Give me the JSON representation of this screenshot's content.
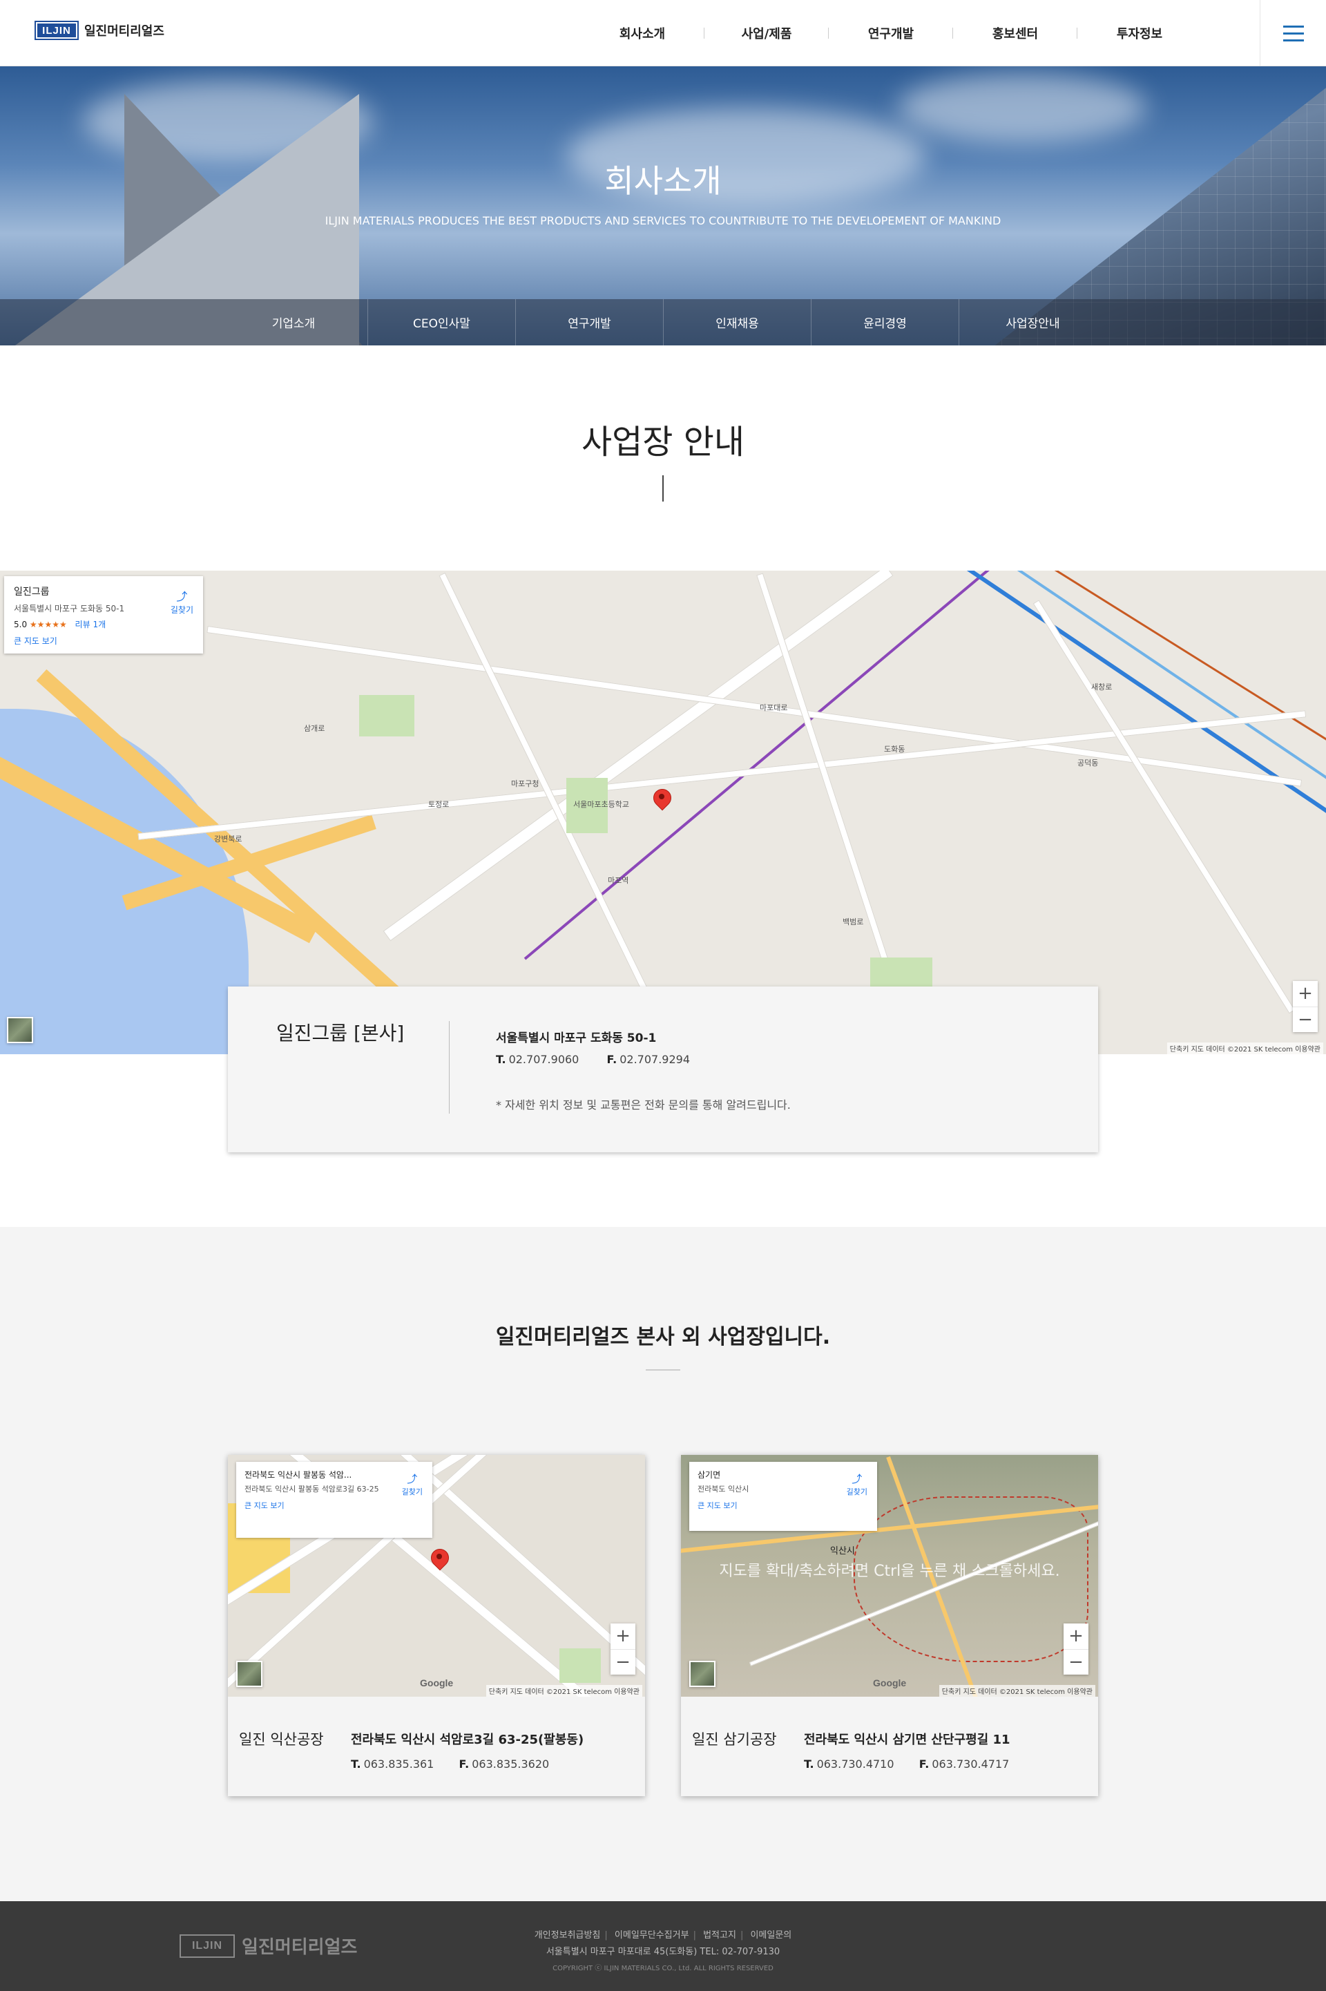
{
  "header": {
    "logo_mark": "ILJIN",
    "logo_text": "일진머티리얼즈",
    "nav": [
      "회사소개",
      "사업/제품",
      "연구개발",
      "홍보센터",
      "투자정보"
    ]
  },
  "hero": {
    "title": "회사소개",
    "subtitle": "ILJIN MATERIALS PRODUCES THE BEST PRODUCTS AND SERVICES TO COUNTRIBUTE TO THE DEVELOPEMENT OF MANKIND",
    "subnav": [
      "기업소개",
      "CEO인사말",
      "연구개발",
      "인재채용",
      "윤리경영",
      "사업장안내"
    ]
  },
  "section": {
    "title": "사업장 안내"
  },
  "main_map": {
    "info_name": "일진그룹",
    "info_address": "서울특별시 마포구 도화동 50-1",
    "info_rating": "5.0",
    "info_stars": "★★★★★",
    "info_reviews": "리뷰 1개",
    "info_link": "큰 지도 보기",
    "info_dir": "길찾기",
    "attribution": "단축키  지도 데이터 ©2021 SK telecom  이용약관",
    "labels": [
      "마포대로",
      "도화동",
      "공덕동",
      "마포구청",
      "서울마포초등학교",
      "새창로",
      "마포역",
      "강변북로",
      "토정로",
      "백범로",
      "삼개로"
    ]
  },
  "hq": {
    "name": "일진그룹 [본사]",
    "address": "서울특별시 마포구 도화동 50-1",
    "tel_label": "T.",
    "tel": "02.707.9060",
    "fax_label": "F.",
    "fax": "02.707.9294",
    "note": "* 자세한 위치 정보 및 교통편은 전화 문의를 통해 알려드립니다."
  },
  "plants_section": {
    "title": "일진머티리얼즈 본사 외 사업장입니다."
  },
  "plants": [
    {
      "name": "일진 익산공장",
      "address": "전라북도 익산시 석암로3길 63-25(팔봉동)",
      "tel_label": "T.",
      "tel": "063.835.361",
      "fax_label": "F.",
      "fax": "063.835.3620",
      "map_title": "전라북도 익산시 팔봉동 석암...",
      "map_sub": "전라북도 익산시 팔봉동 석암로3길 63-25",
      "map_link": "큰 지도 보기",
      "map_dir": "길찾기",
      "attribution": "단축키  지도 데이터 ©2021 SK telecom  이용약관"
    },
    {
      "name": "일진 삼기공장",
      "address": "전라북도 익산시 삼기면 산단구평길 11",
      "tel_label": "T.",
      "tel": "063.730.4710",
      "fax_label": "F.",
      "fax": "063.730.4717",
      "map_title": "삼기면",
      "map_sub": "전라북도 익산시",
      "map_link": "큰 지도 보기",
      "map_dir": "길찾기",
      "overlay": "지도를 확대/축소하려면 Ctrl을 누른 채 스크롤하세요.",
      "city_label": "익산시",
      "attribution": "단축키  지도 데이터 ©2021 SK telecom  이용약관"
    }
  ],
  "footer": {
    "logo_mark": "ILJIN",
    "logo_text": "일진머티리얼즈",
    "links": [
      "개인정보취급방침",
      "이메일무단수집거부",
      "법적고지",
      "이메일문의"
    ],
    "address": "서울특별시 마포구 마포대로 45(도화동) TEL: 02-707-9130",
    "copyright": "COPYRIGHT ⓒ ILJIN MATERIALS CO., Ltd. ALL RIGHTS RESERVED"
  },
  "colors": {
    "brand": "#1f4e9a",
    "menu_icon": "#1f6fb5",
    "footer_bg": "#3a3a3a",
    "section_bg": "#f4f4f4",
    "pin": "#e8372e"
  }
}
